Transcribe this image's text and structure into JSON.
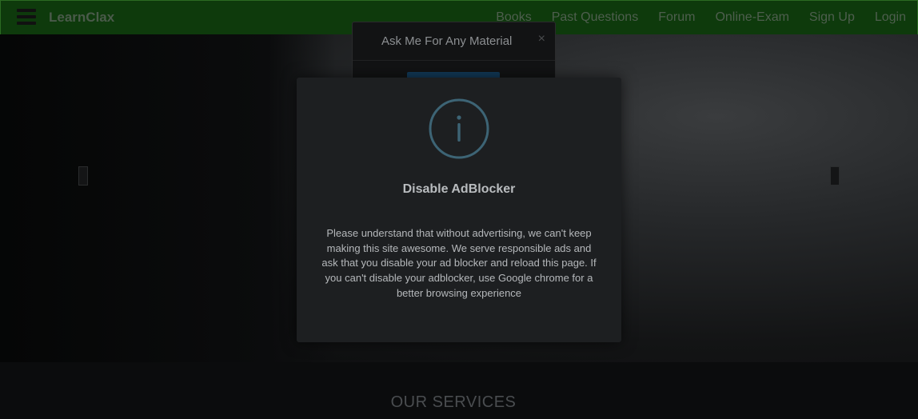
{
  "navbar": {
    "brand": "LearnClax",
    "links": [
      "Books",
      "Past Questions",
      "Forum",
      "Online-Exam",
      "Sign Up",
      "Login"
    ]
  },
  "ask_modal": {
    "title": "Ask Me For Any Material",
    "close": "×"
  },
  "adblock_modal": {
    "icon": "info-icon",
    "title": "Disable AdBlocker",
    "message": "Please understand that without advertising, we can't keep making this site awesome. We serve responsible ads and ask that you disable your ad blocker and reload this page. If you can't disable your adblocker, use Google chrome for a better browsing experience"
  },
  "services": {
    "title": "OUR SERVICES"
  },
  "colors": {
    "navbar_bg": "#0e3a0c",
    "modal_bg": "#1d1f21",
    "icon_stroke": "#3d6475"
  }
}
